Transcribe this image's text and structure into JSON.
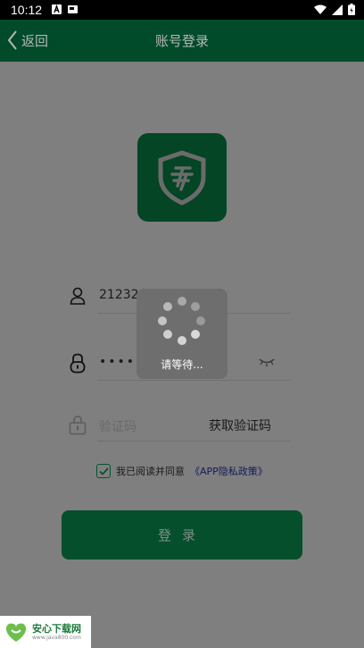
{
  "status_bar": {
    "time": "10:12",
    "icons": [
      "notification-a-icon",
      "notification-card-icon",
      "wifi-icon",
      "cellular-icon",
      "battery-icon"
    ]
  },
  "header": {
    "back_label": "返回",
    "title": "账号登录"
  },
  "form": {
    "account_value": "212321",
    "password_value": "••••••",
    "verify_placeholder": "验证码",
    "get_code_label": "获取验证码",
    "agree_text": "我已阅读并同意",
    "agree_checked": true,
    "privacy_link": "《APP隐私政策》",
    "login_label": "登录"
  },
  "loading": {
    "text": "请等待..."
  },
  "watermark": {
    "name": "安心下载网",
    "url": "www.java800.com"
  },
  "colors": {
    "header_bg": "#014b2a",
    "accent": "#05522e",
    "overlay": "#7f7f7f"
  }
}
